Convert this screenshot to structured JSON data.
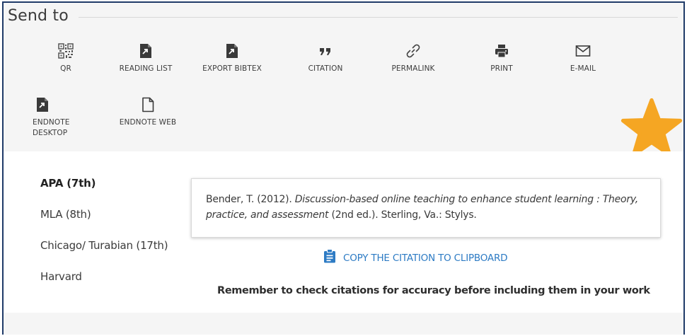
{
  "header": {
    "title": "Send to"
  },
  "actions": [
    {
      "label": "QR",
      "icon": "qr-code-icon"
    },
    {
      "label": "READING LIST",
      "icon": "reading-list-icon"
    },
    {
      "label": "EXPORT BIBTEX",
      "icon": "export-bibtex-icon"
    },
    {
      "label": "CITATION",
      "icon": "quote-icon"
    },
    {
      "label": "PERMALINK",
      "icon": "link-icon"
    },
    {
      "label": "PRINT",
      "icon": "printer-icon"
    },
    {
      "label": "E-MAIL",
      "icon": "envelope-icon"
    },
    {
      "label_line1": "ENDNOTE",
      "label_line2": "DESKTOP",
      "icon": "endnote-desktop-icon"
    },
    {
      "label": "ENDNOTE WEB",
      "icon": "document-icon"
    }
  ],
  "citation_styles": [
    {
      "label": "APA (7th)",
      "selected": true
    },
    {
      "label": "MLA (8th)"
    },
    {
      "label": "Chicago/ Turabian (17th)"
    },
    {
      "label": "Harvard"
    }
  ],
  "citation": {
    "prefix": "Bender, T. (2012). ",
    "title_italic": "Discussion-based online teaching to enhance student learning : Theory, practice, and assessment",
    "suffix": " (2nd ed.). Sterling, Va.: Stylys."
  },
  "copy_button": {
    "label": "COPY THE CITATION TO CLIPBOARD",
    "icon": "clipboard-icon"
  },
  "reminder": "Remember to check citations for accuracy before including them in your work",
  "colors": {
    "accent": "#2d7bc4",
    "star": "#f5a623",
    "frame": "#1f3a68"
  }
}
